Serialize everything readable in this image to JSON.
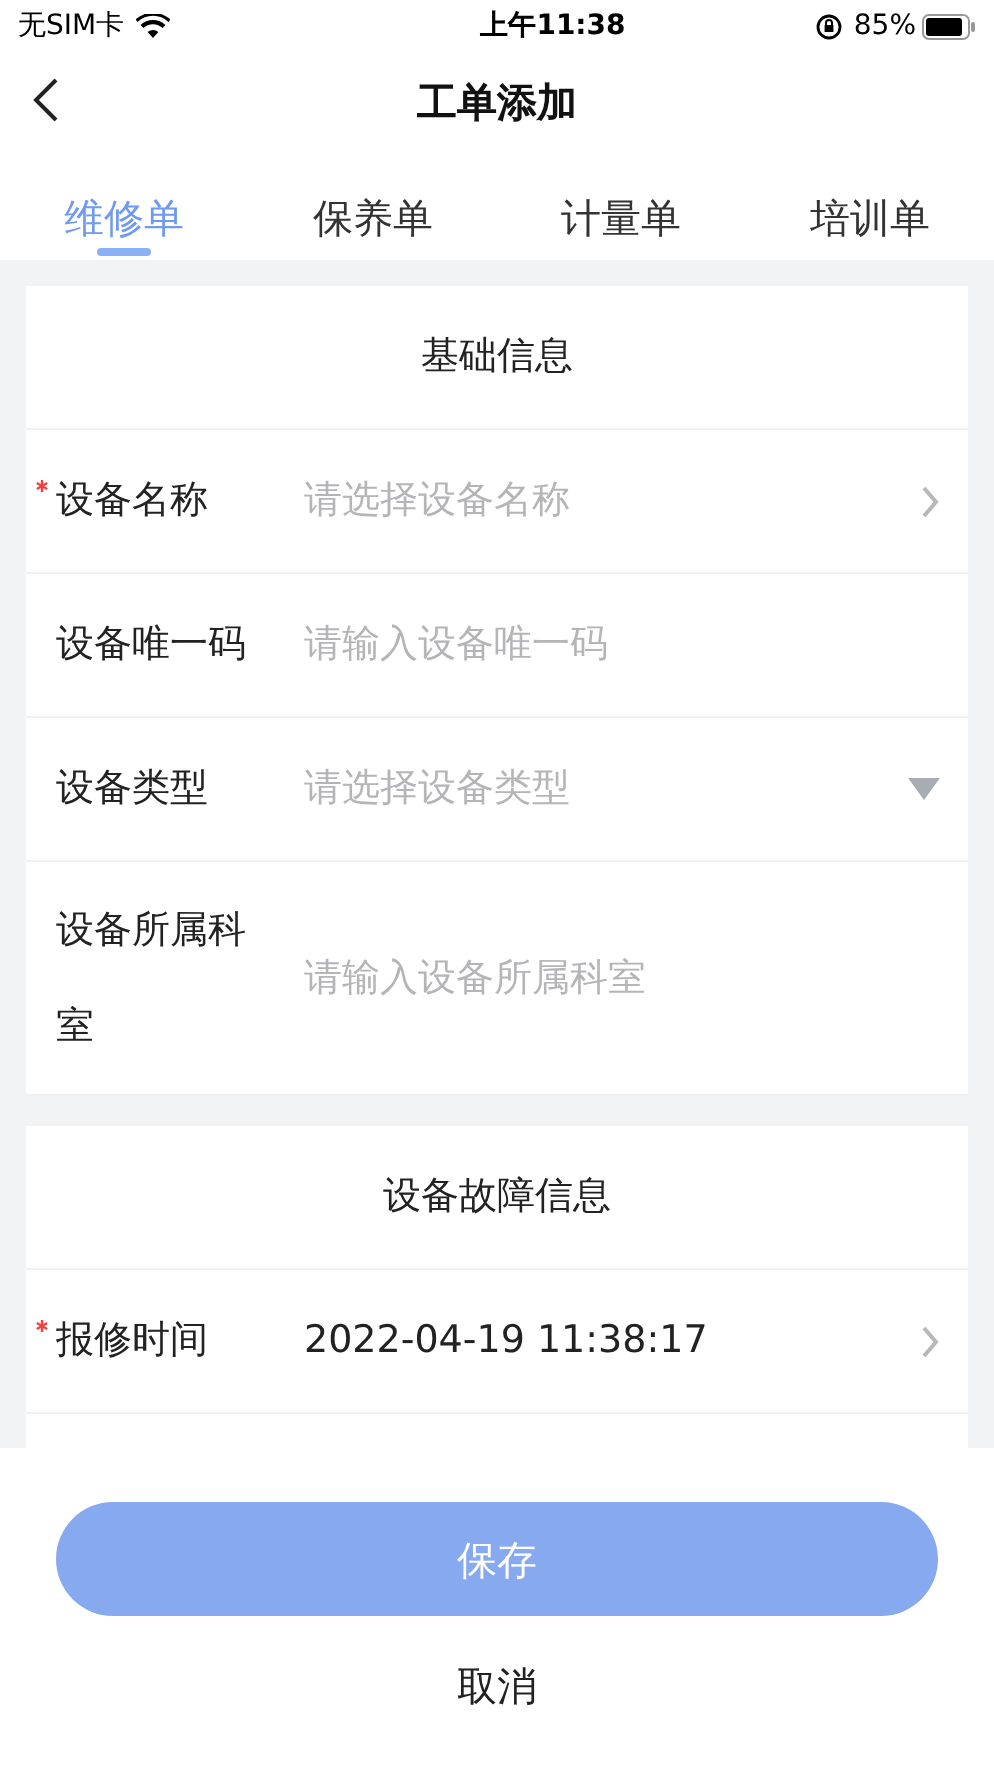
{
  "status_bar": {
    "carrier": "无SIM卡",
    "time": "上午11:38",
    "battery": "85%"
  },
  "nav": {
    "title": "工单添加"
  },
  "tabs": [
    {
      "label": "维修单",
      "selected": true
    },
    {
      "label": "保养单",
      "selected": false
    },
    {
      "label": "计量单",
      "selected": false
    },
    {
      "label": "培训单",
      "selected": false
    }
  ],
  "sections": [
    {
      "title": "基础信息",
      "fields": [
        {
          "label": "设备名称",
          "required": true,
          "kind": "picker",
          "placeholder": "请选择设备名称"
        },
        {
          "label": "设备唯一码",
          "required": false,
          "kind": "input",
          "placeholder": "请输入设备唯一码"
        },
        {
          "label": "设备类型",
          "required": false,
          "kind": "dropdown",
          "placeholder": "请选择设备类型"
        },
        {
          "label": "设备所属科室",
          "required": false,
          "kind": "input",
          "placeholder": "请输入设备所属科室"
        }
      ]
    },
    {
      "title": "设备故障信息",
      "fields": [
        {
          "label": "报修时间",
          "required": true,
          "kind": "picker",
          "value": "2022-04-19 11:38:17"
        }
      ]
    }
  ],
  "buttons": {
    "save": "保存",
    "cancel": "取消"
  }
}
